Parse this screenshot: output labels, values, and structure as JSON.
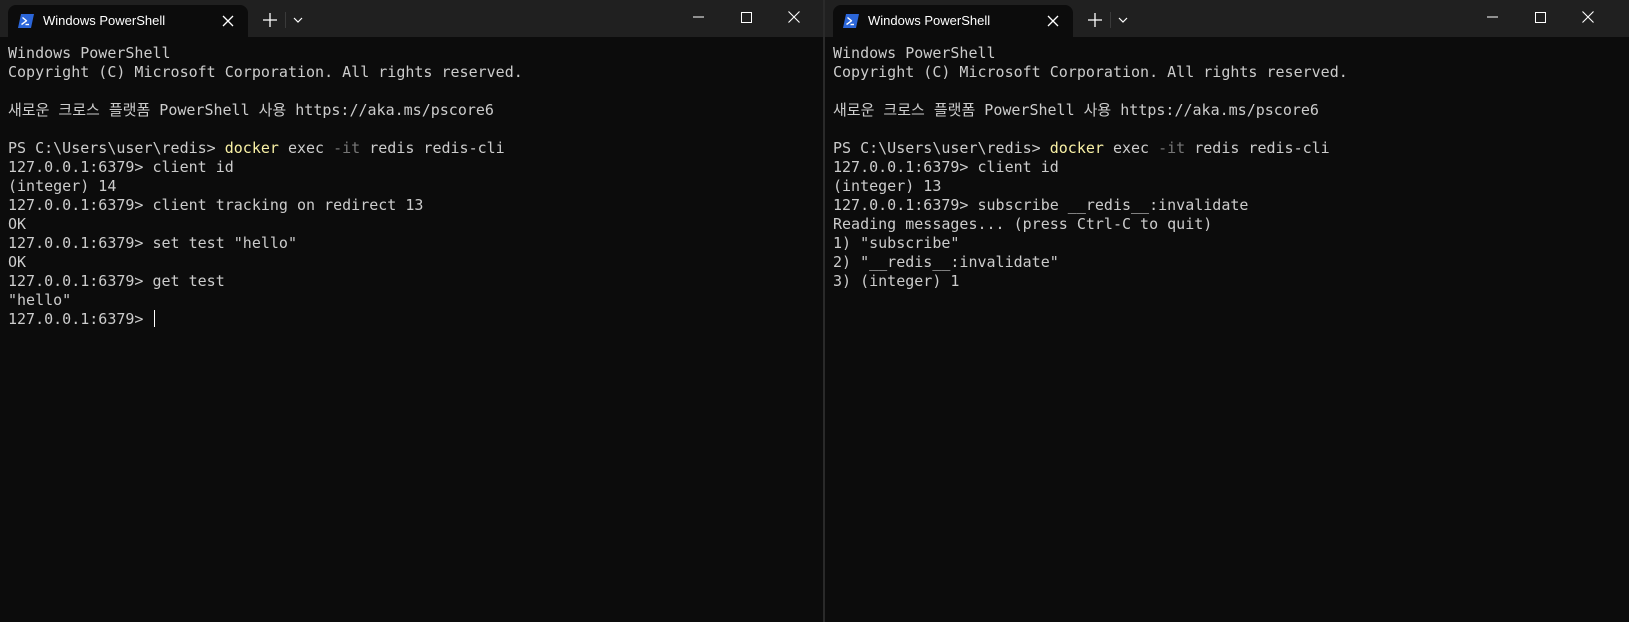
{
  "left_window": {
    "tab_title": "Windows PowerShell",
    "lines": [
      {
        "text": "Windows PowerShell"
      },
      {
        "text": "Copyright (C) Microsoft Corporation. All rights reserved."
      },
      {
        "text": ""
      },
      {
        "text": "새로운 크로스 플랫폼 PowerShell 사용 https://aka.ms/pscore6"
      },
      {
        "text": ""
      },
      {
        "prompt": "PS C:\\Users\\user\\redis> ",
        "exe": "docker",
        "mid": " exec ",
        "flag": "-it",
        "rest": " redis redis-cli"
      },
      {
        "text": "127.0.0.1:6379> client id"
      },
      {
        "text": "(integer) 14"
      },
      {
        "text": "127.0.0.1:6379> client tracking on redirect 13"
      },
      {
        "text": "OK"
      },
      {
        "text": "127.0.0.1:6379> set test \"hello\""
      },
      {
        "text": "OK"
      },
      {
        "text": "127.0.0.1:6379> get test"
      },
      {
        "text": "\"hello\""
      },
      {
        "text": "127.0.0.1:6379> ",
        "cursor": true
      }
    ]
  },
  "right_window": {
    "tab_title": "Windows PowerShell",
    "lines": [
      {
        "text": "Windows PowerShell"
      },
      {
        "text": "Copyright (C) Microsoft Corporation. All rights reserved."
      },
      {
        "text": ""
      },
      {
        "text": "새로운 크로스 플랫폼 PowerShell 사용 https://aka.ms/pscore6"
      },
      {
        "text": ""
      },
      {
        "prompt": "PS C:\\Users\\user\\redis> ",
        "exe": "docker",
        "mid": " exec ",
        "flag": "-it",
        "rest": " redis redis-cli"
      },
      {
        "text": "127.0.0.1:6379> client id"
      },
      {
        "text": "(integer) 13"
      },
      {
        "text": "127.0.0.1:6379> subscribe __redis__:invalidate"
      },
      {
        "text": "Reading messages... (press Ctrl-C to quit)"
      },
      {
        "text": "1) \"subscribe\""
      },
      {
        "text": "2) \"__redis__:invalidate\""
      },
      {
        "text": "3) (integer) 1"
      }
    ]
  },
  "icons": {
    "tab_icon": "powershell-icon",
    "close": "close-icon",
    "new_tab": "plus-icon",
    "dropdown": "chevron-down-icon",
    "minimize": "minimize-icon",
    "maximize": "maximize-icon",
    "window_close": "window-close-icon"
  },
  "colors": {
    "background": "#0c0c0c",
    "titlebar": "#202020",
    "text": "#cccccc",
    "command": "#f9f1a5",
    "parameter": "#767676",
    "powershell_icon": "#2b66d9"
  }
}
